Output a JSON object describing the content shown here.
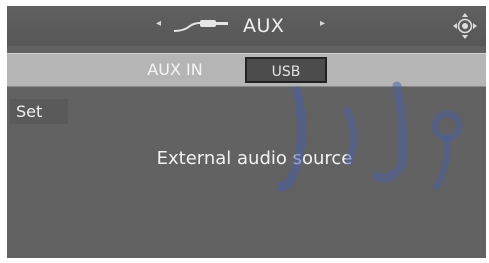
{
  "header": {
    "title": "AUX",
    "left_arrow": "◂",
    "right_arrow": "▸",
    "source_icon": "aux-cable-icon",
    "controller_icon": "controller-joystick-icon"
  },
  "tabs": [
    {
      "label": "AUX IN",
      "selected": false
    },
    {
      "label": "USB",
      "selected": true
    }
  ],
  "menu": {
    "set_label": "Set"
  },
  "main": {
    "description": "External audio source"
  },
  "colors": {
    "screen_bg": "#626262",
    "tabbar_bg": "#b5b5b5",
    "selected_tab_bg": "#4c4c4c",
    "text": "#f2f2f2"
  }
}
